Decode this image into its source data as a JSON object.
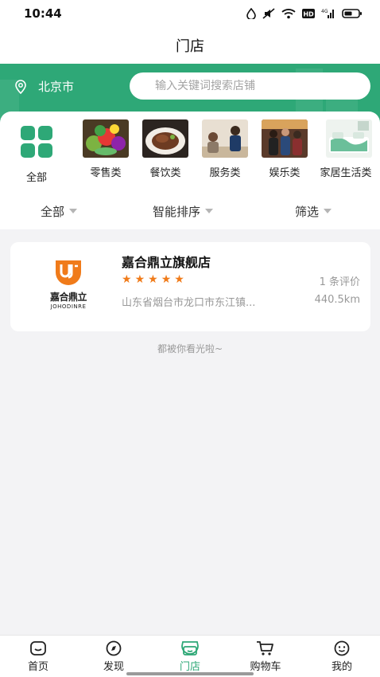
{
  "status_bar": {
    "time": "10:44"
  },
  "header": {
    "title": "门店"
  },
  "location": {
    "city": "北京市"
  },
  "search": {
    "placeholder": "输入关键词搜索店铺"
  },
  "categories": [
    {
      "label": "全部",
      "icon": "grid-icon"
    },
    {
      "label": "零售类",
      "icon": "vegetables-photo"
    },
    {
      "label": "餐饮类",
      "icon": "steak-photo"
    },
    {
      "label": "服务类",
      "icon": "service-photo"
    },
    {
      "label": "娱乐类",
      "icon": "people-photo"
    },
    {
      "label": "家居生活类",
      "icon": "bedroom-photo"
    }
  ],
  "filters": [
    {
      "label": "全部"
    },
    {
      "label": "智能排序"
    },
    {
      "label": "筛选"
    }
  ],
  "stores": [
    {
      "name": "嘉合鼎立旗舰店",
      "logo_text_zh": "嘉合鼎立",
      "logo_text_en": "JOHODINRE",
      "rating": 5,
      "reviews": "1 条评价",
      "address": "山东省烟台市龙口市东江镇...",
      "distance": "440.5km"
    }
  ],
  "list_end_text": "都被你看光啦~",
  "tabbar": [
    {
      "label": "首页",
      "icon": "home-icon"
    },
    {
      "label": "发现",
      "icon": "compass-icon"
    },
    {
      "label": "门店",
      "icon": "store-icon",
      "active": true
    },
    {
      "label": "购物车",
      "icon": "cart-icon"
    },
    {
      "label": "我的",
      "icon": "profile-icon"
    }
  ],
  "colors": {
    "brand": "#2ea877",
    "star": "#f07b1a",
    "muted": "#999999"
  }
}
